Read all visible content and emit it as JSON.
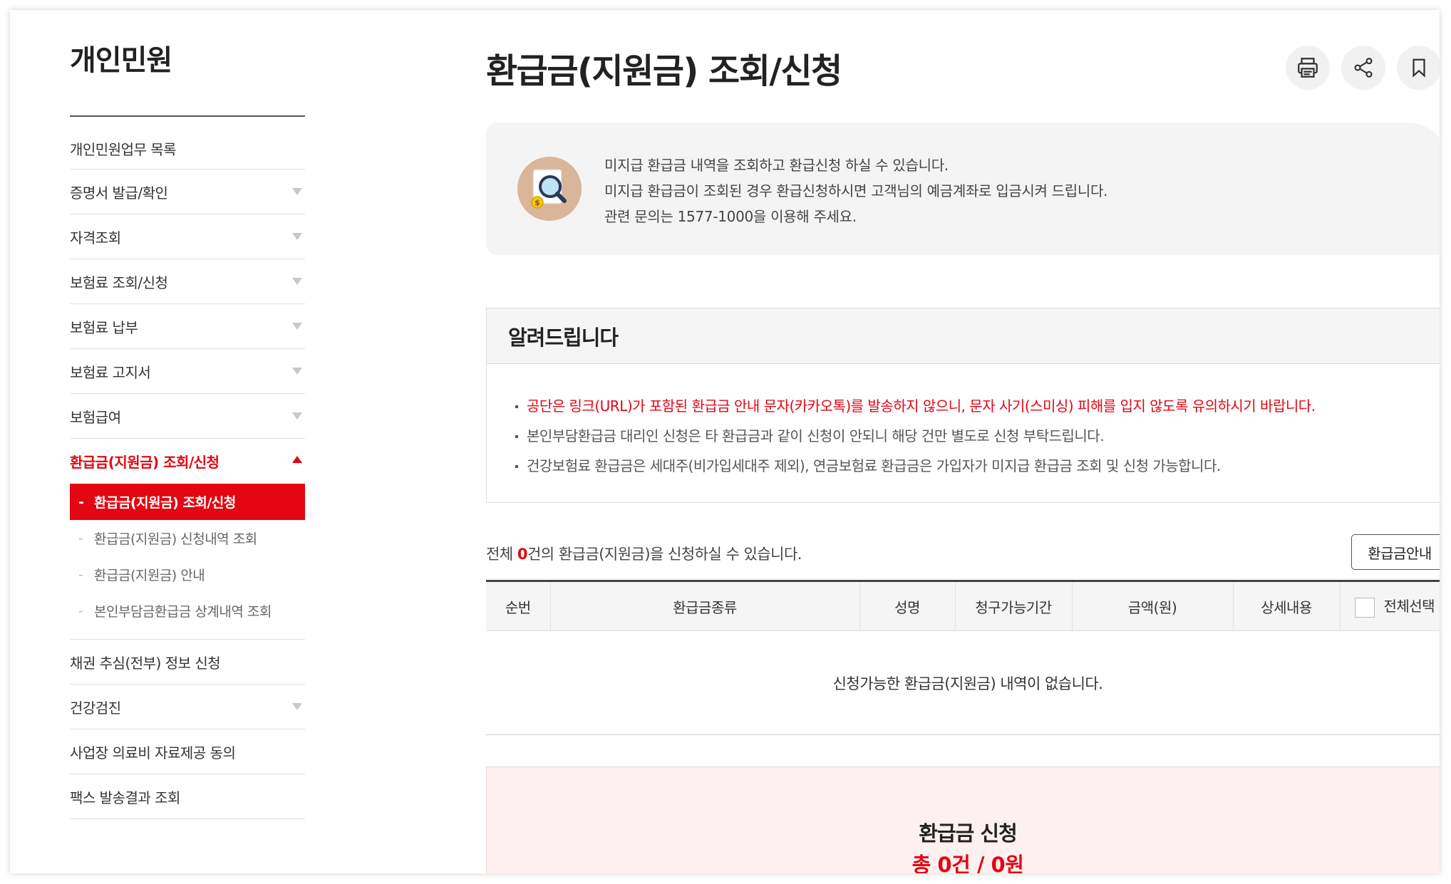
{
  "sidebar": {
    "title": "개인민원",
    "items": [
      {
        "label": "개인민원업무 목록"
      },
      {
        "label": "증명서 발급/확인"
      },
      {
        "label": "자격조회"
      },
      {
        "label": "보험료 조회/신청"
      },
      {
        "label": "보험료 납부"
      },
      {
        "label": "보험료 고지서"
      },
      {
        "label": "보험급여"
      },
      {
        "label": "환급금(지원금) 조회/신청"
      },
      {
        "label": "채권 추심(전부) 정보 신청"
      },
      {
        "label": "건강검진"
      },
      {
        "label": "사업장 의료비 자료제공 동의"
      },
      {
        "label": "팩스 발송결과 조회"
      }
    ],
    "sub_items": [
      {
        "label": "환급금(지원금) 조회/신청"
      },
      {
        "label": "환급금(지원금) 신청내역 조회"
      },
      {
        "label": "환급금(지원금) 안내"
      },
      {
        "label": "본인부담금환급금 상계내역 조회"
      }
    ]
  },
  "page": {
    "title": "환급금(지원금) 조회/신청",
    "tools": [
      "print-icon",
      "share-icon",
      "bookmark-icon"
    ]
  },
  "info": {
    "line1": "미지급 환급금 내역을 조회하고 환급신청 하실 수 있습니다.",
    "line2": "미지급 환급금이 조회된 경우 환급신청하시면 고객님의 예금계좌로 입금시켜 드립니다.",
    "line3": "관련 문의는 1577-1000을 이용해 주세요."
  },
  "notice": {
    "heading": "알려드립니다",
    "items": [
      "공단은 링크(URL)가 포함된 환급금 안내 문자(카카오톡)를 발송하지 않으니, 문자 사기(스미싱) 피해를 입지 않도록 유의하시기 바랍니다.",
      "본인부담환급금 대리인 신청은 타 환급금과 같이 신청이 안되니 해당 건만 별도로 신청 부탁드립니다.",
      "건강보험료 환급금은 세대주(비가입세대주 제외), 연금보험료 환급금은 가입자가 미지급 환급금 조회 및 신청 가능합니다."
    ]
  },
  "summary": {
    "prefix": "전체 ",
    "count": "0",
    "suffix": "건의 환급금(지원금)을 신청하실 수 있습니다.",
    "guide_button": "환급금안내"
  },
  "table": {
    "headers": [
      "순번",
      "환급금종류",
      "성명",
      "청구가능기간",
      "금액(원)",
      "상세내용",
      "전체선택"
    ],
    "empty_message": "신청가능한 환급금(지원금) 내역이 없습니다."
  },
  "apply": {
    "title": "환급금 신청",
    "total": "총 0건 / 0원"
  },
  "colors": {
    "accent": "#e30613",
    "info_bg": "#f4f4f4",
    "apply_bg": "#fdf0f0"
  }
}
